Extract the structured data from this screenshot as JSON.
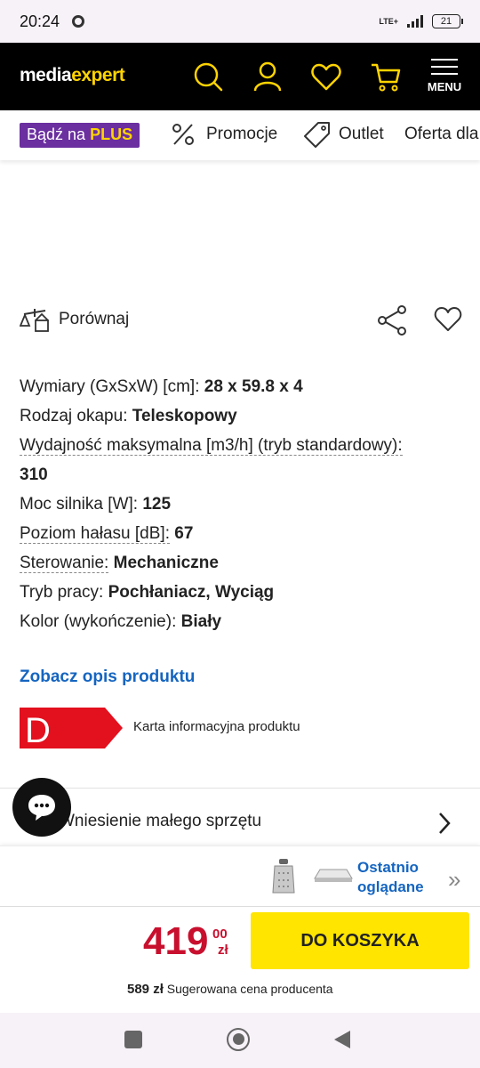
{
  "status_bar": {
    "time": "20:24",
    "network": "LTE+",
    "battery": "21"
  },
  "header": {
    "logo_part1": "media",
    "logo_part2": "expert",
    "icons": [
      "search-icon",
      "user-icon",
      "heart-icon",
      "cart-icon"
    ],
    "menu_label": "MENU"
  },
  "nav": {
    "plus_prefix": "Bądź na",
    "plus_word": "PLUS",
    "items": [
      "Promocje",
      "Outlet",
      "Oferta dla"
    ]
  },
  "compare": {
    "label": "Porównaj"
  },
  "specs": [
    {
      "label": "Wymiary (GxSxW) [cm]:",
      "value": "28 x 59.8 x 4"
    },
    {
      "label": "Rodzaj okapu:",
      "value": "Teleskopowy"
    },
    {
      "label": "Wydajność maksymalna [m3/h] (tryb standardowy):",
      "value": "310"
    },
    {
      "label": "Moc silnika [W]:",
      "value": "125"
    },
    {
      "label": "Poziom hałasu [dB]:",
      "value": "67"
    },
    {
      "label": "Sterowanie:",
      "value": "Mechaniczne"
    },
    {
      "label": "Tryb pracy:",
      "value": "Pochłaniacz, Wyciąg"
    },
    {
      "label": "Kolor (wykończenie):",
      "value": "Biały"
    }
  ],
  "description_link": "Zobacz opis produktu",
  "energy": {
    "class": "D",
    "label": "Karta informacyjna produktu",
    "color": "#e3101e"
  },
  "service": {
    "label": "Wniesienie małego sprzętu"
  },
  "recent": {
    "line1": "Ostatnio",
    "line2": "oglądane"
  },
  "buy": {
    "price_main": "419",
    "price_decimal": "00",
    "currency": "zł",
    "cart_button": "DO KOSZYKA",
    "rrp_value": "589 zł",
    "rrp_label": "Sugerowana cena producenta"
  },
  "colors": {
    "accent_yellow": "#ffe500",
    "price_red": "#c8102e",
    "link_blue": "#1565c0",
    "plus_purple": "#6b2fa0"
  }
}
